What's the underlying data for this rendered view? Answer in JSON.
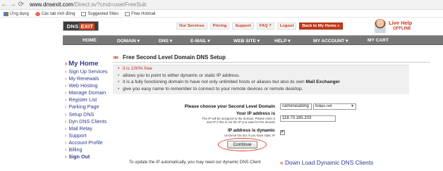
{
  "browser": {
    "url_host": "www.dnsexit.com",
    "url_path": "/Direct.sv?cmd=userFreeSub",
    "bookmarks": [
      {
        "label": "Ứng dụng",
        "icon": "apps-grid-icon"
      },
      {
        "label": "Các tab mới đóng",
        "icon": "recent-tabs-icon"
      },
      {
        "label": "Suggested Sites",
        "icon": "page-icon"
      },
      {
        "label": "Free Hotmail",
        "icon": "page-icon"
      }
    ]
  },
  "header": {
    "logo_dns": "DNS",
    "logo_exit": "EXIT",
    "top_links": [
      "Our Services",
      "Pricing",
      "Support",
      "FAQ ?",
      "Logout",
      "Back to My Home »"
    ],
    "live_help_title": "Live Help",
    "live_help_status": "OFFLINE"
  },
  "nav": {
    "items": [
      "HOME",
      "DOMAIN ▾",
      "DNS ▾",
      "E-MAIL ▾",
      "WEB SITE ▾",
      "HELP ▾",
      "MY ACCOUNT ▾",
      "MY CART"
    ]
  },
  "sidebar": {
    "title": "My Home",
    "items": [
      "Sign Up Services",
      "My Renewals",
      "Web Hosting",
      "Manage Domain",
      "Register List",
      "Parking Page",
      "Setup DNS",
      "Dyn DNS Clients",
      "Mail Relay",
      "Support",
      "Account Profile",
      "Billing",
      "Sign Out"
    ]
  },
  "main": {
    "title": "Free Second Level Domain DNS Setup",
    "features": [
      {
        "text": "it is 100% free",
        "bold": ""
      },
      {
        "text": "allows you to point to either dynamic or static IP address.",
        "bold": ""
      },
      {
        "text": "it is a fully functioning domain to have not only unlimited hosts or aliases but also its own ",
        "bold": "Mail Exchanger"
      },
      {
        "text": "give you easy name to remember to connect to your remote devices or remote desktop.",
        "bold": ""
      }
    ],
    "form": {
      "domain_label": "Please choose your Second Level Domain",
      "domain_value": "camerasalong",
      "domain_suffix": "linkpc.net",
      "ip_label": "Your IP address is",
      "ip_hint_1": "The IP will be assigned to the domain. Please enter a",
      "ip_hint_2": "new IP if this is not the IP you want for the domain",
      "ip_value": "118.70.185.203",
      "dynamic_label": "IP address is dynamic",
      "dynamic_hint": "Uncheck the box if you have static IP",
      "dynamic_checked": "✔",
      "continue_label": "Continue"
    },
    "bottom_note": "To update the IP automatically, you may need our dynamic DNS Client",
    "bottom_link": "Down Load Dynamic DNS Clients"
  },
  "colors": {
    "accent": "#c63a1b",
    "nav_bg": "#777777",
    "link": "#2e3a8c",
    "features_bg": "#f0f0f0"
  }
}
